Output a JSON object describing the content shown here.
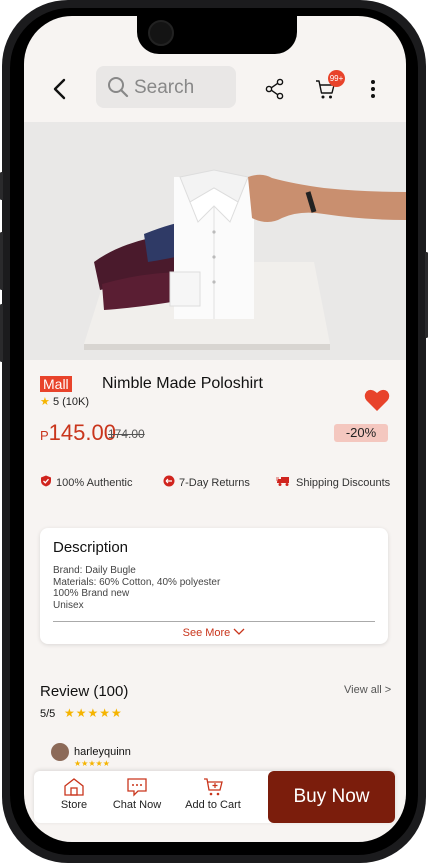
{
  "header": {
    "search_placeholder": "Search",
    "cart_badge": "99+"
  },
  "product": {
    "mall_tag": "Mall",
    "name": "Nimble Made Poloshirt",
    "rating": "5 (10K)",
    "price_currency": "P",
    "price": "145.00",
    "old_price": "174.00",
    "discount": "-20%",
    "features": [
      "100% Authentic",
      "7-Day Returns",
      "Shipping Discounts"
    ]
  },
  "description": {
    "title": "Description",
    "lines": [
      "Brand: Daily Bugle",
      "Materials: 60% Cotton, 40% polyester",
      "100% Brand new",
      "Unisex"
    ],
    "see_more": "See More"
  },
  "review": {
    "title": "Review (100)",
    "view_all": "View all >",
    "score": "5/5",
    "stars": "★★★★★",
    "user": "harleyquinn",
    "user_stars": "★★★★★"
  },
  "bottom_bar": {
    "store": "Store",
    "chat": "Chat Now",
    "add_to_cart": "Add to Cart",
    "buy_now": "Buy Now"
  },
  "colors": {
    "accent": "#e8432b",
    "price": "#c9351c",
    "buy_button": "#7b1d0c",
    "star": "#f5b400"
  }
}
